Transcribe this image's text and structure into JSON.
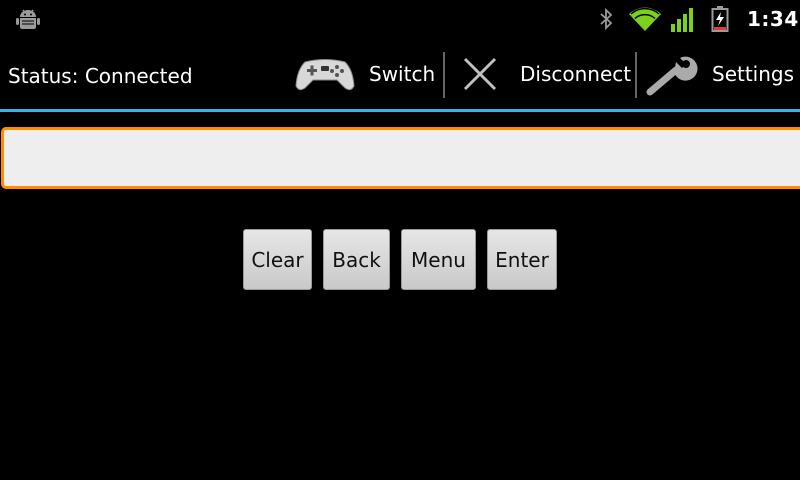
{
  "status_bar": {
    "time": "1:34",
    "icons": [
      "android-debug-icon",
      "bluetooth-icon",
      "wifi-icon",
      "cell-signal-icon",
      "battery-charging-icon"
    ]
  },
  "action_bar": {
    "status_text": "Status: Connected",
    "items": [
      {
        "label": "Switch",
        "icon": "gamepad-icon"
      },
      {
        "label": "Disconnect",
        "icon": "close-icon"
      },
      {
        "label": "Settings",
        "icon": "wrench-icon"
      }
    ],
    "accent_color": "#33b5e5"
  },
  "input": {
    "value": "",
    "focus_color": "#ff8c00"
  },
  "buttons": {
    "clear": "Clear",
    "back": "Back",
    "menu": "Menu",
    "enter": "Enter"
  }
}
